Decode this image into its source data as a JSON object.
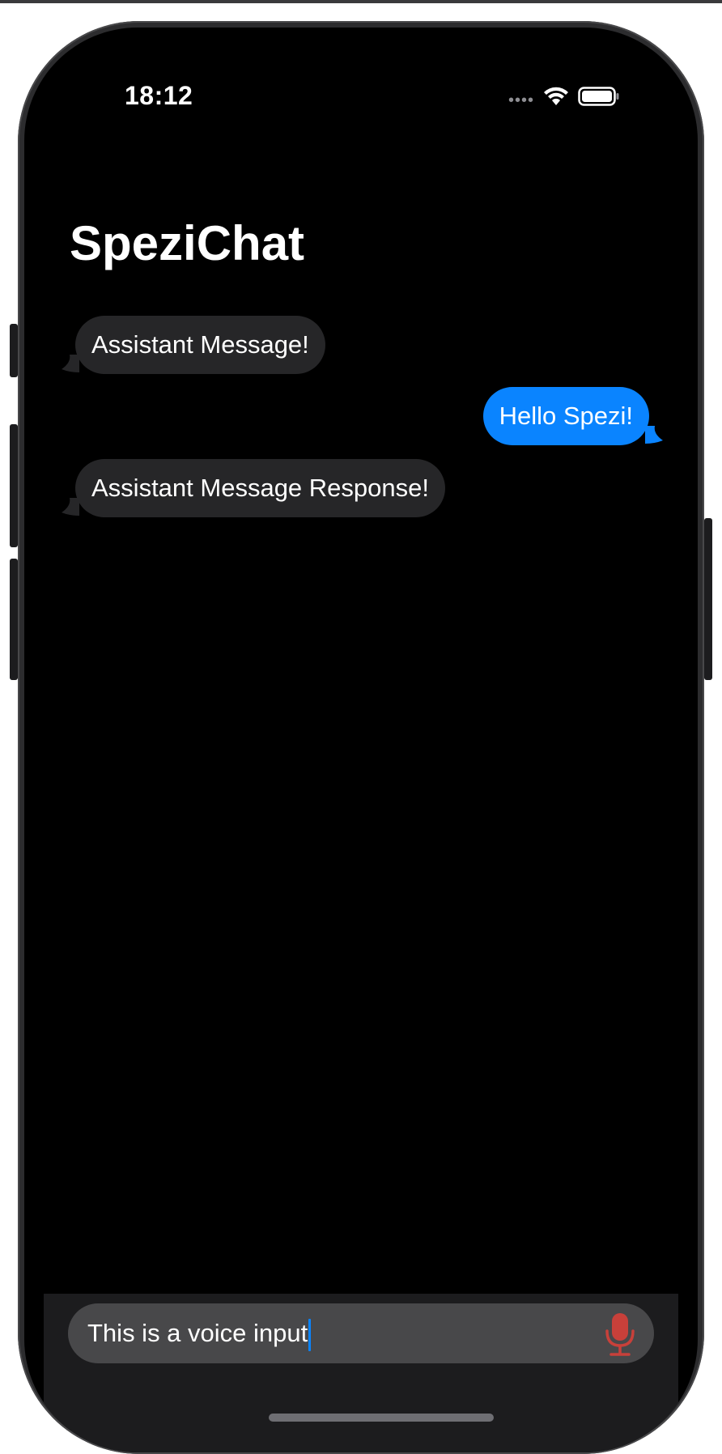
{
  "status_bar": {
    "time": "18:12",
    "icons": [
      "cellular-signal-icon",
      "wifi-icon",
      "battery-icon"
    ]
  },
  "app": {
    "title": "SpeziChat"
  },
  "messages": [
    {
      "role": "assistant",
      "text": "Assistant Message!"
    },
    {
      "role": "user",
      "text": "Hello Spezi!"
    },
    {
      "role": "assistant",
      "text": "Assistant Message Response!"
    }
  ],
  "input": {
    "value": "This is a voice input",
    "mic_icon": "microphone-icon",
    "mic_color": "#c8403a"
  },
  "colors": {
    "user_bubble": "#0a84ff",
    "assistant_bubble": "#262628",
    "background": "#000000"
  }
}
